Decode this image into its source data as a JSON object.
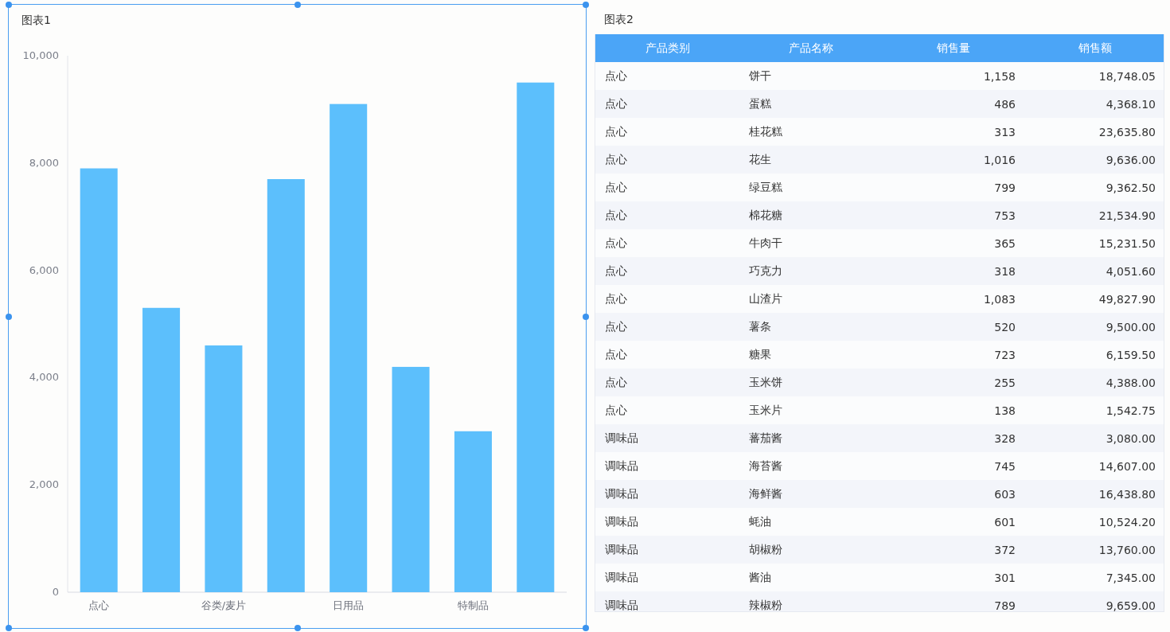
{
  "chart1": {
    "title": "图表1",
    "chart_data": {
      "type": "bar",
      "categories": [
        "点心",
        null,
        "谷类/麦片",
        null,
        "日用品",
        null,
        "特制品",
        null
      ],
      "series": [
        {
          "color": "#5cbffc",
          "values": [
            7900,
            5300,
            4600,
            7700,
            9100,
            4200,
            3000,
            9500
          ]
        }
      ],
      "ylim": [
        0,
        10000
      ],
      "yticks": [
        {
          "value": 0,
          "label": "0"
        },
        {
          "value": 2000,
          "label": "2,000"
        },
        {
          "value": 4000,
          "label": "4,000"
        },
        {
          "value": 6000,
          "label": "6,000"
        },
        {
          "value": 8000,
          "label": "8,000"
        },
        {
          "value": 10000,
          "label": "10,000"
        }
      ]
    }
  },
  "chart2": {
    "title": "图表2",
    "table": {
      "columns": [
        "产品类别",
        "产品名称",
        "销售量",
        "销售额"
      ],
      "rows": [
        [
          "点心",
          "饼干",
          "1,158",
          "18,748.05"
        ],
        [
          "点心",
          "蛋糕",
          "486",
          "4,368.10"
        ],
        [
          "点心",
          "桂花糕",
          "313",
          "23,635.80"
        ],
        [
          "点心",
          "花生",
          "1,016",
          "9,636.00"
        ],
        [
          "点心",
          "绿豆糕",
          "799",
          "9,362.50"
        ],
        [
          "点心",
          "棉花糖",
          "753",
          "21,534.90"
        ],
        [
          "点心",
          "牛肉干",
          "365",
          "15,231.50"
        ],
        [
          "点心",
          "巧克力",
          "318",
          "4,051.60"
        ],
        [
          "点心",
          "山渣片",
          "1,083",
          "49,827.90"
        ],
        [
          "点心",
          "薯条",
          "520",
          "9,500.00"
        ],
        [
          "点心",
          "糖果",
          "723",
          "6,159.50"
        ],
        [
          "点心",
          "玉米饼",
          "255",
          "4,388.00"
        ],
        [
          "点心",
          "玉米片",
          "138",
          "1,542.75"
        ],
        [
          "调味品",
          "蕃茄酱",
          "328",
          "3,080.00"
        ],
        [
          "调味品",
          "海苔酱",
          "745",
          "14,607.00"
        ],
        [
          "调味品",
          "海鲜酱",
          "603",
          "16,438.80"
        ],
        [
          "调味品",
          "蚝油",
          "601",
          "10,524.20"
        ],
        [
          "调味品",
          "胡椒粉",
          "372",
          "13,760.00"
        ],
        [
          "调味品",
          "酱油",
          "301",
          "7,345.00"
        ],
        [
          "调味品",
          "辣椒粉",
          "789",
          "9,659.00"
        ]
      ]
    }
  }
}
